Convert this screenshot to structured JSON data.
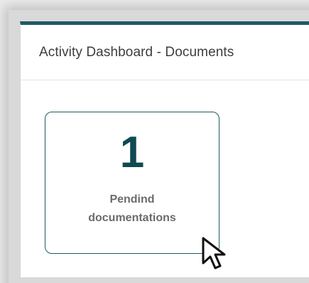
{
  "panel": {
    "title": "Activity Dashboard - Documents"
  },
  "card": {
    "count": "1",
    "label": "Pendind documentations"
  },
  "colors": {
    "accent": "#1f5a63",
    "count_text": "#0f4a53",
    "label_text": "#6b6b6b"
  },
  "icons": {
    "cursor": "mouse-pointer-icon"
  }
}
